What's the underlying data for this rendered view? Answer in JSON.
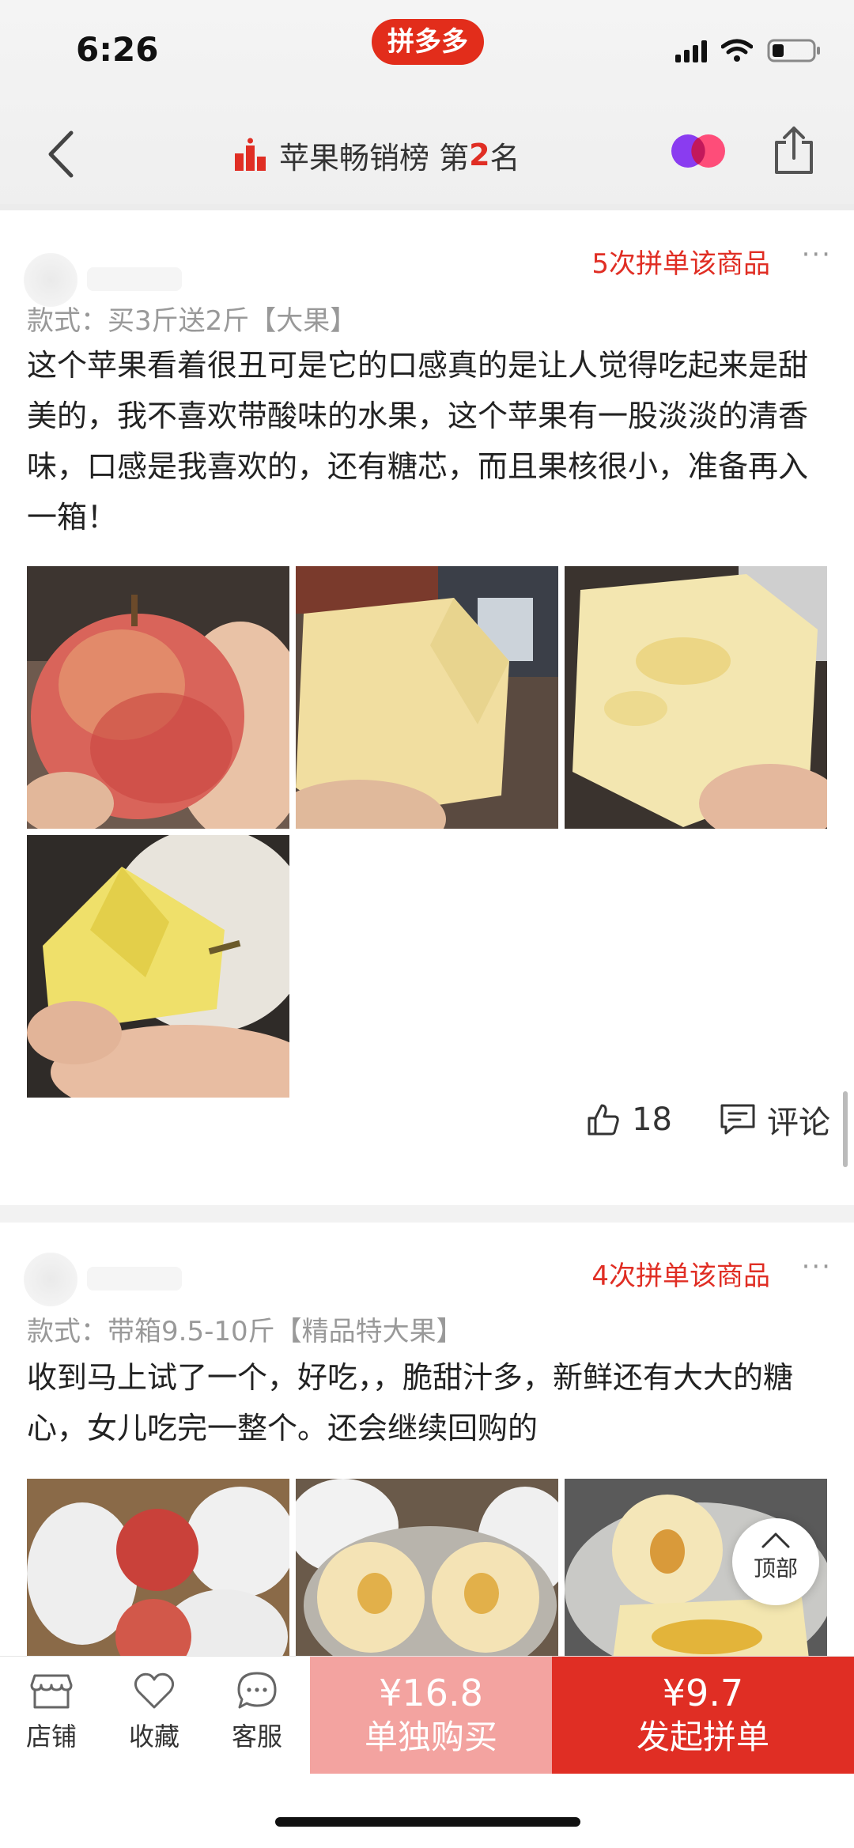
{
  "status_bar": {
    "time": "6:26",
    "brand": "拼多多"
  },
  "nav": {
    "title_prefix": "苹果畅销榜 第",
    "rank": "2",
    "title_suffix": "名"
  },
  "reviews": [
    {
      "order_count": "5次拼单该商品",
      "more": "···",
      "spec": "款式：买3斤送2斤【大果】",
      "text": "这个苹果看着很丑可是它的口感真的是让人觉得吃起来是甜美的，我不喜欢带酸味的水果，这个苹果有一股淡淡的清香味，口感是我喜欢的，还有糖芯，而且果核很小，准备再入一箱！",
      "likes": "18",
      "comment_label": "评论"
    },
    {
      "order_count": "4次拼单该商品",
      "more": "···",
      "spec": "款式：带箱9.5-10斤【精品特大果】",
      "text": "收到马上试了一个，好吃，，脆甜汁多，新鲜还有大大的糖心，女儿吃完一整个。还会继续回购的"
    }
  ],
  "top_button": {
    "label": "顶部"
  },
  "bottom_bar": {
    "store_label": "店铺",
    "favorite_label": "收藏",
    "service_label": "客服",
    "single_price": "¥16.8",
    "single_label": "单独购买",
    "group_price": "¥9.7",
    "group_label": "发起拼单"
  },
  "colors": {
    "accent": "#e02e24",
    "single_button": "#f3a3a0"
  }
}
